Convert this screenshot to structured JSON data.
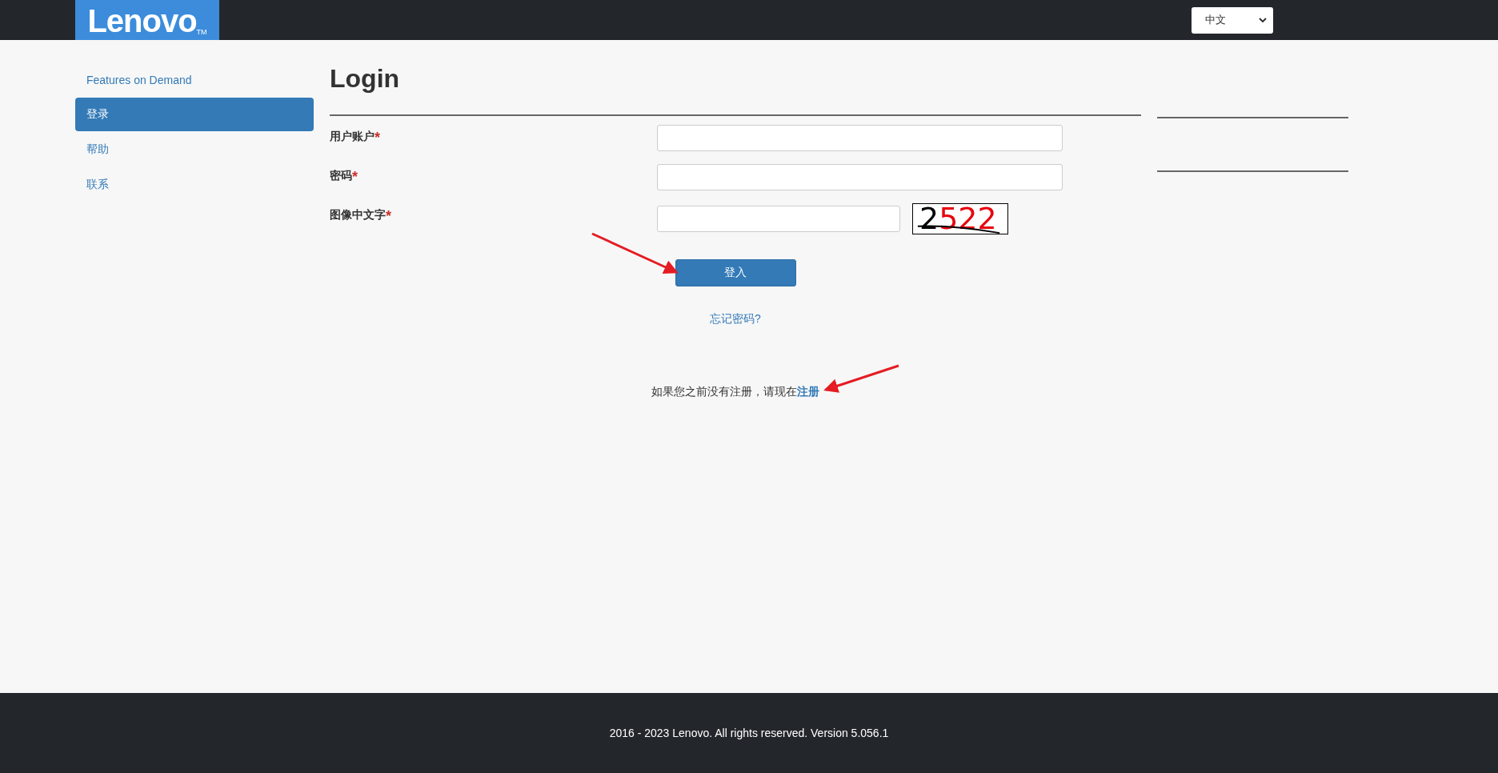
{
  "header": {
    "logo": "Lenovo",
    "logo_mark": "TM",
    "language": {
      "value": "中文"
    }
  },
  "sidebar": {
    "items": [
      {
        "label": "Features on Demand",
        "selected": false
      },
      {
        "label": "登录",
        "selected": true
      },
      {
        "label": "帮助",
        "selected": false
      },
      {
        "label": "联系",
        "selected": false
      }
    ]
  },
  "main": {
    "title": "Login",
    "fields": [
      {
        "label": "用户账户",
        "mark": "*",
        "kind": "text"
      },
      {
        "label": "密码",
        "mark": "*",
        "kind": "password"
      },
      {
        "label": "图像中文字",
        "mark": "*",
        "kind": "captcha"
      }
    ],
    "captcha": {
      "parts": [
        {
          "text": "2",
          "color": "#000000"
        },
        {
          "text": "522",
          "color": "#e8000b"
        }
      ]
    },
    "submit": "登入",
    "forgot": "忘记密码?",
    "register": {
      "text": "如果您之前没有注册，请现在",
      "link": "注册"
    }
  },
  "footer": {
    "text": "2016 - 2023 Lenovo. All rights reserved. Version 5.056.1"
  }
}
